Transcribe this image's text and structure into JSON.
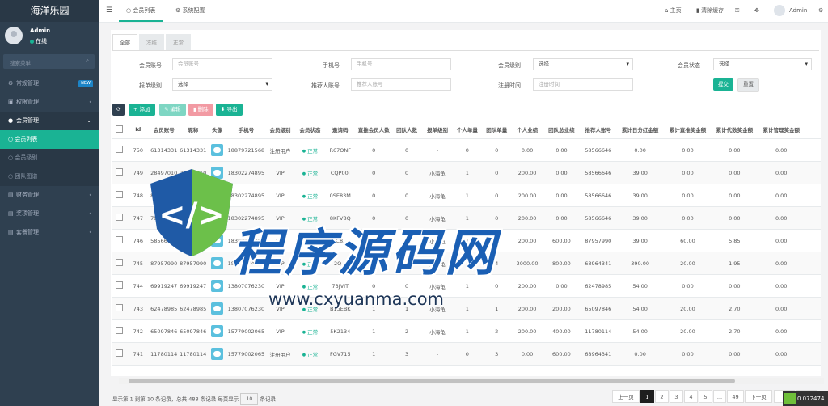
{
  "app": {
    "title": "海洋乐园"
  },
  "profile": {
    "name": "Admin",
    "status": "在线"
  },
  "sidebar": {
    "search_placeholder": "搜索菜单",
    "items": [
      {
        "label": "常规管理",
        "badge": "NEW"
      },
      {
        "label": "权限管理"
      },
      {
        "label": "会员管理"
      },
      {
        "label": "财务管理"
      },
      {
        "label": "奖项管理"
      },
      {
        "label": "套餐管理"
      }
    ],
    "subitems": [
      "会员列表",
      "会员级别",
      "团队图谱"
    ]
  },
  "topbar": {
    "tabs": [
      "会员列表",
      "系统配置"
    ],
    "home": "主页",
    "clear_cache": "清除缓存",
    "user": "Admin"
  },
  "filter_tabs": [
    "全部",
    "冻结",
    "正常"
  ],
  "filters": {
    "member_account": {
      "label": "会员账号",
      "placeholder": "会员账号"
    },
    "phone": {
      "label": "手机号",
      "placeholder": "手机号"
    },
    "member_level": {
      "label": "会员级别",
      "value": "选择"
    },
    "member_status": {
      "label": "会员状态",
      "value": "选择"
    },
    "order_level": {
      "label": "报单级别",
      "value": "选择"
    },
    "referrer": {
      "label": "推荐人账号",
      "placeholder": "推荐人账号"
    },
    "reg_time": {
      "label": "注册时间",
      "placeholder": "注册时间"
    },
    "submit": "提交",
    "reset": "重置"
  },
  "toolbar": {
    "add": "添加",
    "edit": "编辑",
    "delete": "删除",
    "export": "导出"
  },
  "table": {
    "headers": [
      "Id",
      "会员账号",
      "昵称",
      "头像",
      "手机号",
      "会员级别",
      "会员状态",
      "邀请码",
      "直推会员人数",
      "团队人数",
      "报单级别",
      "个人单量",
      "团队单量",
      "个人业绩",
      "团队总业绩",
      "推荐人账号",
      "累计日分红金额",
      "累计直推奖金额",
      "累计代数奖金额",
      "累计管理奖金额"
    ],
    "rows": [
      [
        "750",
        "61314331",
        "61314331",
        "18879721568",
        "注册用户",
        "正常",
        "R67ONF",
        "0",
        "0",
        "-",
        "0",
        "0",
        "0.00",
        "0.00",
        "58566646",
        "0.00",
        "0.00",
        "0.00",
        "0.00"
      ],
      [
        "749",
        "28497010",
        "28497010",
        "18302274895",
        "VIP",
        "正常",
        "CQP00I",
        "0",
        "0",
        "小海龟",
        "1",
        "0",
        "200.00",
        "0.00",
        "58566646",
        "39.00",
        "0.00",
        "0.00",
        "0.00"
      ],
      [
        "748",
        "83116461",
        "83116461",
        "18302274895",
        "VIP",
        "正常",
        "0SE83M",
        "0",
        "0",
        "小海龟",
        "1",
        "0",
        "200.00",
        "0.00",
        "58566646",
        "39.00",
        "0.00",
        "0.00",
        "0.00"
      ],
      [
        "747",
        "79616112",
        "79616112",
        "18302274895",
        "VIP",
        "正常",
        "8KFV8Q",
        "0",
        "0",
        "小海龟",
        "1",
        "0",
        "200.00",
        "0.00",
        "58566646",
        "39.00",
        "0.00",
        "0.00",
        "0.00"
      ],
      [
        "746",
        "58566646",
        "58566646",
        "18302274895",
        "VIP",
        "正常",
        "3C8...",
        "4",
        "4",
        "小海龟",
        "1",
        "3",
        "200.00",
        "600.00",
        "87957990",
        "39.00",
        "60.00",
        "5.85",
        "0.00"
      ],
      [
        "745",
        "87957990",
        "87957990",
        "18302274895",
        "VIP",
        "正常",
        "2Q...",
        "1",
        "5",
        "金海龟",
        "1",
        "4",
        "2000.00",
        "800.00",
        "68964341",
        "390.00",
        "20.00",
        "1.95",
        "0.00"
      ],
      [
        "744",
        "69919247",
        "69919247",
        "13807076230",
        "VIP",
        "正常",
        "73JVIT",
        "0",
        "0",
        "小海龟",
        "1",
        "0",
        "200.00",
        "0.00",
        "62478985",
        "54.00",
        "0.00",
        "0.00",
        "0.00"
      ],
      [
        "743",
        "62478985",
        "62478985",
        "13807076230",
        "VIP",
        "正常",
        "B15EBK",
        "1",
        "1",
        "小海龟",
        "1",
        "1",
        "200.00",
        "200.00",
        "65097846",
        "54.00",
        "20.00",
        "2.70",
        "0.00"
      ],
      [
        "742",
        "65097846",
        "65097846",
        "15779002065",
        "VIP",
        "正常",
        "5K2134",
        "1",
        "2",
        "小海龟",
        "1",
        "2",
        "200.00",
        "400.00",
        "11780114",
        "54.00",
        "20.00",
        "2.70",
        "0.00"
      ],
      [
        "741",
        "11780114",
        "11780114",
        "15779002065",
        "注册用户",
        "正常",
        "FGV715",
        "1",
        "3",
        "-",
        "0",
        "3",
        "0.00",
        "600.00",
        "68964341",
        "0.00",
        "0.00",
        "0.00",
        "0.00"
      ]
    ]
  },
  "footer": {
    "info_prefix": "显示第 1 到第 10 条记录，总共 488 条记录 每页显示",
    "page_size": "10",
    "info_suffix": "条记录"
  },
  "pager": {
    "prev": "上一页",
    "pages": [
      "1",
      "2",
      "3",
      "4",
      "5",
      "...",
      "49"
    ],
    "next": "下一页",
    "jump": "跳转"
  },
  "watermark": {
    "text": "程序源码网",
    "url": "www.cxyuanma.com"
  },
  "corner": {
    "value": "0.072474"
  },
  "colors": {
    "sidebar": "#2f4050",
    "accent": "#1ab394",
    "danger": "#ed5565",
    "edit": "#1ab394"
  }
}
